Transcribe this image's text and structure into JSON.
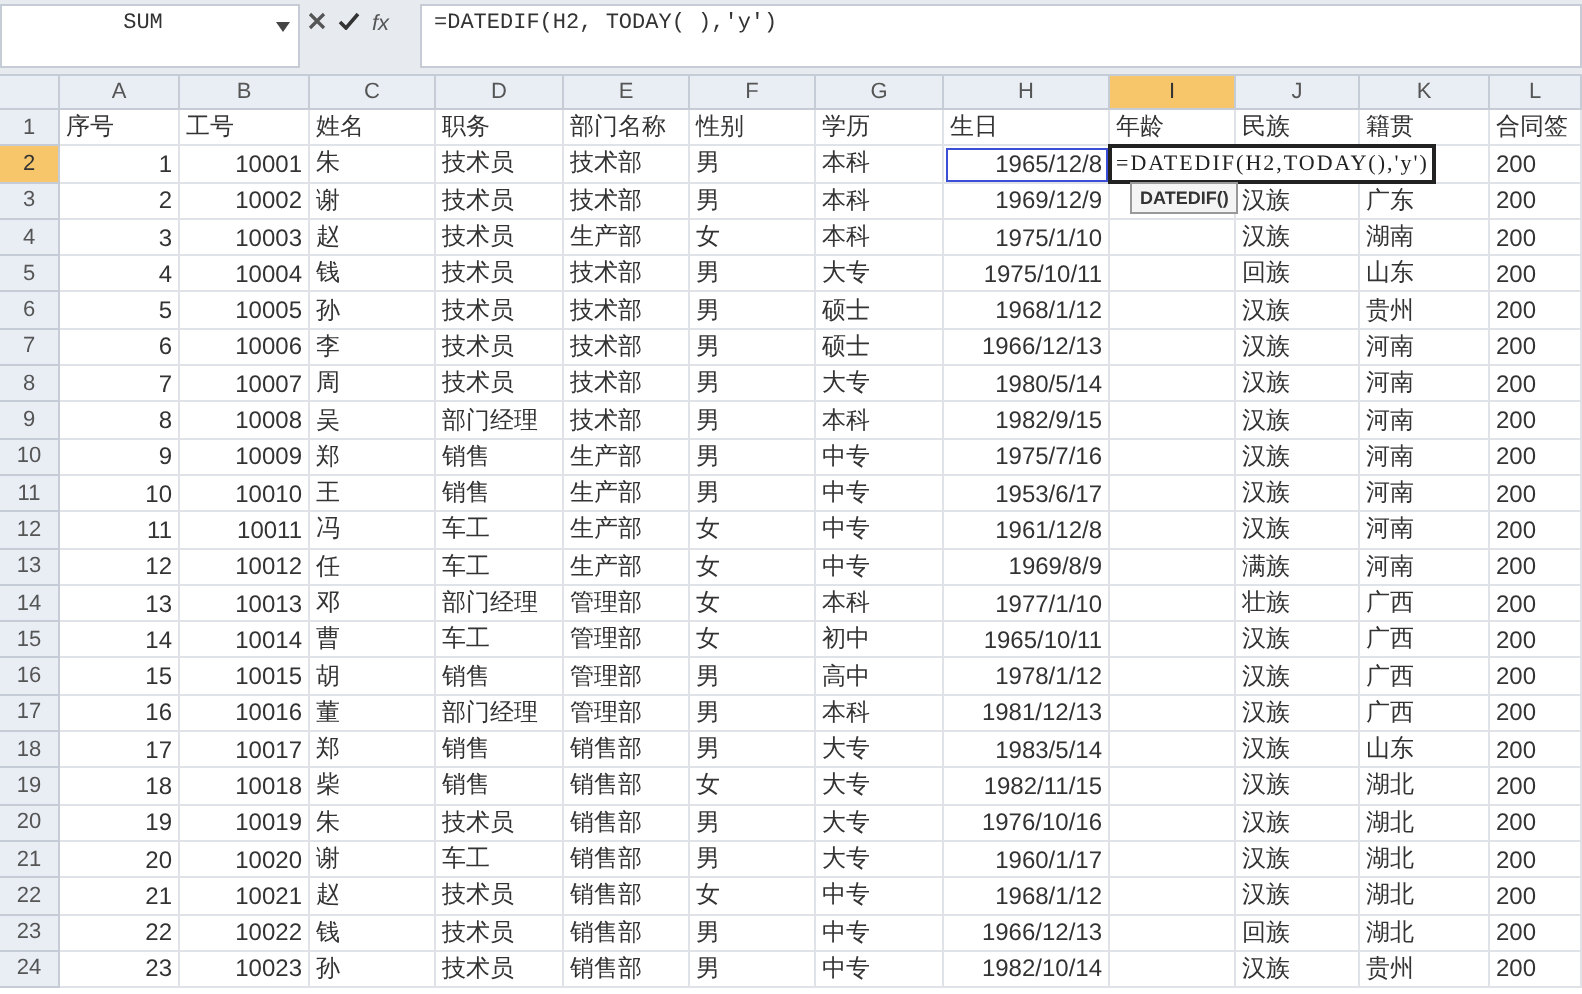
{
  "name_box": {
    "value": "SUM"
  },
  "formula_bar": {
    "function_button": "fx",
    "value": "=DATEDIF(H2, TODAY( ),'y')"
  },
  "editor": {
    "value": "=DATEDIF(H2,TODAY(),'y')",
    "tooltip": "DATEDIF()"
  },
  "columns": [
    {
      "label": "A",
      "selected": false,
      "referenced": false
    },
    {
      "label": "B",
      "selected": false,
      "referenced": false
    },
    {
      "label": "C",
      "selected": false,
      "referenced": false
    },
    {
      "label": "D",
      "selected": false,
      "referenced": false
    },
    {
      "label": "E",
      "selected": false,
      "referenced": false
    },
    {
      "label": "F",
      "selected": false,
      "referenced": false
    },
    {
      "label": "G",
      "selected": false,
      "referenced": false
    },
    {
      "label": "H",
      "selected": false,
      "referenced": true
    },
    {
      "label": "I",
      "selected": true,
      "referenced": false
    },
    {
      "label": "J",
      "selected": false,
      "referenced": false
    },
    {
      "label": "K",
      "selected": false,
      "referenced": false
    },
    {
      "label": "L",
      "selected": false,
      "referenced": false
    }
  ],
  "rows": [
    {
      "number": "1",
      "selected": false,
      "cells": [
        "序号",
        "工号",
        "姓名",
        "职务",
        "部门名称",
        "性别",
        "学历",
        "生日",
        "年龄",
        "民族",
        "籍贯",
        "合同签"
      ]
    },
    {
      "number": "2",
      "selected": true,
      "cells": [
        "1",
        "10001",
        "朱",
        "技术员",
        "技术部",
        "男",
        "本科",
        "1965/12/8",
        null,
        null,
        null,
        "200"
      ]
    },
    {
      "number": "3",
      "selected": false,
      "cells": [
        "2",
        "10002",
        "谢",
        "技术员",
        "技术部",
        "男",
        "本科",
        "1969/12/9",
        null,
        "汉族",
        "广东",
        "200"
      ]
    },
    {
      "number": "4",
      "selected": false,
      "cells": [
        "3",
        "10003",
        "赵",
        "技术员",
        "生产部",
        "女",
        "本科",
        "1975/1/10",
        null,
        "汉族",
        "湖南",
        "200"
      ]
    },
    {
      "number": "5",
      "selected": false,
      "cells": [
        "4",
        "10004",
        "钱",
        "技术员",
        "技术部",
        "男",
        "大专",
        "1975/10/11",
        null,
        "回族",
        "山东",
        "200"
      ]
    },
    {
      "number": "6",
      "selected": false,
      "cells": [
        "5",
        "10005",
        "孙",
        "技术员",
        "技术部",
        "男",
        "硕士",
        "1968/1/12",
        null,
        "汉族",
        "贵州",
        "200"
      ]
    },
    {
      "number": "7",
      "selected": false,
      "cells": [
        "6",
        "10006",
        "李",
        "技术员",
        "技术部",
        "男",
        "硕士",
        "1966/12/13",
        null,
        "汉族",
        "河南",
        "200"
      ]
    },
    {
      "number": "8",
      "selected": false,
      "cells": [
        "7",
        "10007",
        "周",
        "技术员",
        "技术部",
        "男",
        "大专",
        "1980/5/14",
        null,
        "汉族",
        "河南",
        "200"
      ]
    },
    {
      "number": "9",
      "selected": false,
      "cells": [
        "8",
        "10008",
        "吴",
        "部门经理",
        "技术部",
        "男",
        "本科",
        "1982/9/15",
        null,
        "汉族",
        "河南",
        "200"
      ]
    },
    {
      "number": "10",
      "selected": false,
      "cells": [
        "9",
        "10009",
        "郑",
        "销售",
        "生产部",
        "男",
        "中专",
        "1975/7/16",
        null,
        "汉族",
        "河南",
        "200"
      ]
    },
    {
      "number": "11",
      "selected": false,
      "cells": [
        "10",
        "10010",
        "王",
        "销售",
        "生产部",
        "男",
        "中专",
        "1953/6/17",
        null,
        "汉族",
        "河南",
        "200"
      ]
    },
    {
      "number": "12",
      "selected": false,
      "cells": [
        "11",
        "10011",
        "冯",
        "车工",
        "生产部",
        "女",
        "中专",
        "1961/12/8",
        null,
        "汉族",
        "河南",
        "200"
      ]
    },
    {
      "number": "13",
      "selected": false,
      "cells": [
        "12",
        "10012",
        "任",
        "车工",
        "生产部",
        "女",
        "中专",
        "1969/8/9",
        null,
        "满族",
        "河南",
        "200"
      ]
    },
    {
      "number": "14",
      "selected": false,
      "cells": [
        "13",
        "10013",
        "邓",
        "部门经理",
        "管理部",
        "女",
        "本科",
        "1977/1/10",
        null,
        "壮族",
        "广西",
        "200"
      ]
    },
    {
      "number": "15",
      "selected": false,
      "cells": [
        "14",
        "10014",
        "曹",
        "车工",
        "管理部",
        "女",
        "初中",
        "1965/10/11",
        null,
        "汉族",
        "广西",
        "200"
      ]
    },
    {
      "number": "16",
      "selected": false,
      "cells": [
        "15",
        "10015",
        "胡",
        "销售",
        "管理部",
        "男",
        "高中",
        "1978/1/12",
        null,
        "汉族",
        "广西",
        "200"
      ]
    },
    {
      "number": "17",
      "selected": false,
      "cells": [
        "16",
        "10016",
        "董",
        "部门经理",
        "管理部",
        "男",
        "本科",
        "1981/12/13",
        null,
        "汉族",
        "广西",
        "200"
      ]
    },
    {
      "number": "18",
      "selected": false,
      "cells": [
        "17",
        "10017",
        "郑",
        "销售",
        "销售部",
        "男",
        "大专",
        "1983/5/14",
        null,
        "汉族",
        "山东",
        "200"
      ]
    },
    {
      "number": "19",
      "selected": false,
      "cells": [
        "18",
        "10018",
        "柴",
        "销售",
        "销售部",
        "女",
        "大专",
        "1982/11/15",
        null,
        "汉族",
        "湖北",
        "200"
      ]
    },
    {
      "number": "20",
      "selected": false,
      "cells": [
        "19",
        "10019",
        "朱",
        "技术员",
        "销售部",
        "男",
        "大专",
        "1976/10/16",
        null,
        "汉族",
        "湖北",
        "200"
      ]
    },
    {
      "number": "21",
      "selected": false,
      "cells": [
        "20",
        "10020",
        "谢",
        "车工",
        "销售部",
        "男",
        "大专",
        "1960/1/17",
        null,
        "汉族",
        "湖北",
        "200"
      ]
    },
    {
      "number": "22",
      "selected": false,
      "cells": [
        "21",
        "10021",
        "赵",
        "技术员",
        "销售部",
        "女",
        "中专",
        "1968/1/12",
        null,
        "汉族",
        "湖北",
        "200"
      ]
    },
    {
      "number": "23",
      "selected": false,
      "cells": [
        "22",
        "10022",
        "钱",
        "技术员",
        "销售部",
        "男",
        "中专",
        "1966/12/13",
        null,
        "回族",
        "湖北",
        "200"
      ]
    },
    {
      "number": "24",
      "selected": false,
      "cells": [
        "23",
        "10023",
        "孙",
        "技术员",
        "销售部",
        "男",
        "中专",
        "1982/10/14",
        null,
        "汉族",
        "贵州",
        "200"
      ]
    }
  ]
}
